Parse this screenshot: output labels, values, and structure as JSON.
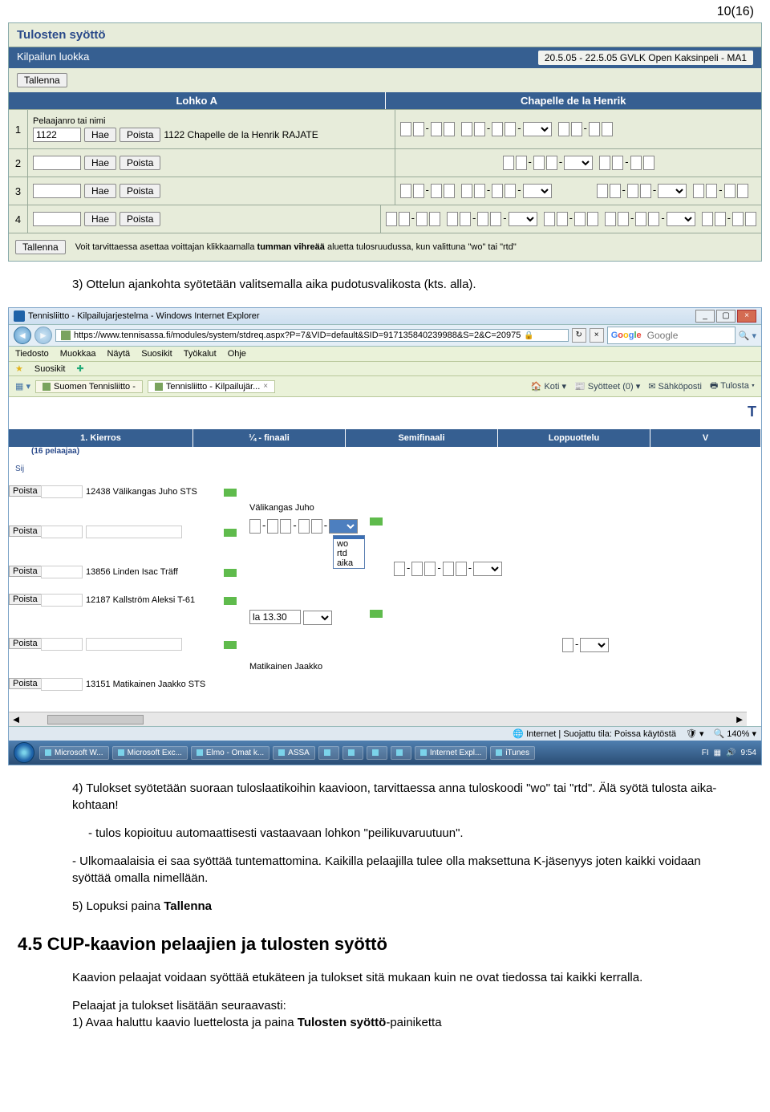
{
  "page_number": "10(16)",
  "shot1": {
    "title": "Tulosten syöttö",
    "kilp_label": "Kilpailun luokka",
    "kilp_value": "20.5.05 - 22.5.05   GVLK Open   Kaksinpeli - MA1",
    "tallenna": "Tallenna",
    "header_left": "Lohko A",
    "header_right": "Chapelle de la Henrik",
    "hae": "Hae",
    "poista": "Poista",
    "row1_label": "Pelaajanro tai nimi",
    "row1_value": "1122",
    "row1_text": "1122 Chapelle de la Henrik  RAJATE",
    "rows": [
      "1",
      "2",
      "3",
      "4"
    ],
    "footer_note_pre": "Voit tarvittaessa asettaa voittajan klikkaamalla ",
    "footer_note_bold": "tumman vihreää",
    "footer_note_post": " aluetta tulosruudussa, kun valittuna \"wo\" tai \"rtd\""
  },
  "text_block1": {
    "item3": "3) Ottelun ajankohta syötetään valitsemalla aika pudotusvalikosta (kts. alla)."
  },
  "shot2": {
    "window_title": "Tennisliitto - Kilpailujarjestelma - Windows Internet Explorer",
    "url": "https://www.tennisassa.fi/modules/system/stdreq.aspx?P=7&VID=default&SID=917135840239988&S=2&C=20975",
    "search_placeholder": "Google",
    "menus": [
      "Tiedosto",
      "Muokkaa",
      "Näytä",
      "Suosikit",
      "Työkalut",
      "Ohje"
    ],
    "fav_label": "Suosikit",
    "tab1": "Suomen Tennisliitto -",
    "tab2": "Tennisliitto - Kilpailujär...",
    "tools": {
      "koti": "Koti",
      "syotteet": "Syötteet (0)",
      "sposti": "Sähköposti",
      "tulosta": "Tulosta"
    },
    "rightT": "T",
    "cols": {
      "c1": "1. Kierros",
      "c1b": "(16 pelaajaa)",
      "c2": "¼ - finaali",
      "c3": "Semifinaali",
      "c4": "Loppuottelu",
      "c5": "V"
    },
    "sij": "Sij",
    "poista": "Poista",
    "rows": {
      "r1": "12438 Välikangas Juho  STS",
      "r2a": "Välikangas Juho",
      "r3": "13856 Linden Isac  Träff",
      "r4": "12187 Kallström Aleksi  T-61",
      "r4b": "la 13.30",
      "r5": "13151 Matikainen Jaakko  STS",
      "r5b": "Matikainen Jaakko",
      "dd": [
        "wo",
        "rtd",
        "aika"
      ]
    },
    "status_left": "",
    "status_mid": "Internet | Suojattu tila: Poissa käytöstä",
    "zoom": "140%",
    "taskbar": {
      "items": [
        "Microsoft W...",
        "Microsoft Exc...",
        "Elmo - Omat k...",
        "ASSA",
        "",
        "",
        "",
        "",
        "Internet Expl...",
        "iTunes"
      ],
      "lang": "FI",
      "time": "9:54"
    }
  },
  "text_block2": {
    "item4a": "4) Tulokset syötetään suoraan tuloslaatikoihin kaavioon, tarvittaessa anna tuloskoodi \"wo\" tai \"rtd\". Älä syötä tulosta aika-kohtaan!",
    "item4b": "-   tulos kopioituu automaattisesti vastaavaan lohkon \"peilikuvaruutuun\".",
    "item4c": "- Ulkomaalaisia ei saa syöttää tuntemattomina. Kaikilla pelaajilla tulee olla maksettuna K-jäsenyys joten kaikki voidaan syöttää omalla nimellään.",
    "item5a": "5) Lopuksi paina ",
    "item5b": "Tallenna"
  },
  "section45": {
    "heading": "4.5 CUP-kaavion pelaajien ja tulosten syöttö",
    "p1": "Kaavion pelaajat voidaan syöttää etukäteen ja tulokset sitä mukaan kuin ne ovat tiedossa tai kaikki kerralla.",
    "p2a": "Pelaajat ja tulokset lisätään seuraavasti:",
    "p2b": "1) Avaa haluttu kaavio luettelosta ja paina ",
    "p2c": "Tulosten syöttö",
    "p2d": "-painiketta"
  }
}
